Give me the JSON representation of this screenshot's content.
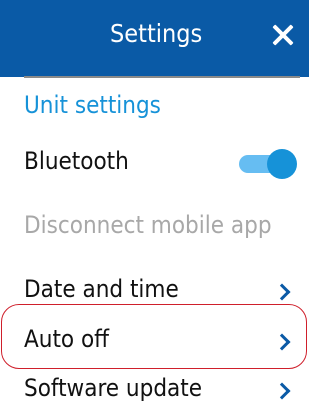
{
  "header": {
    "title": "Settings"
  },
  "section": {
    "label": "Unit settings"
  },
  "settings": {
    "bluetooth": {
      "label": "Bluetooth",
      "enabled": true
    },
    "disconnect_mobile_app": {
      "label": "Disconnect mobile app"
    },
    "date_and_time": {
      "label": "Date and time"
    },
    "auto_off": {
      "label": "Auto off"
    },
    "software_update": {
      "label": "Software update"
    }
  },
  "colors": {
    "header_background": "#0a5aa6",
    "accent_blue": "#1692d8",
    "toggle_track": "#66bdf2",
    "highlight_red": "#cf1f2b",
    "muted_text": "#a8a8a8"
  },
  "icons": {
    "close": "close-icon",
    "chevron": "chevron-right-icon"
  }
}
